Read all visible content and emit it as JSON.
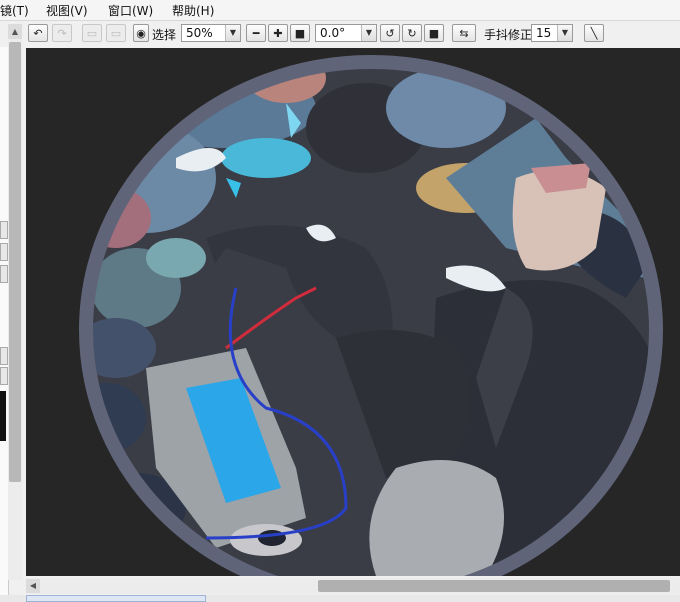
{
  "menubar": {
    "items": [
      "镜(T)",
      "视图(V)",
      "窗口(W)",
      "帮助(H)"
    ]
  },
  "toolbar": {
    "select_label": "选择",
    "zoom": "50%",
    "rotation": "0.0°",
    "stabilizer_label": "手抖修正",
    "stabilizer_value": "15"
  },
  "icons": {
    "undo": "undo-icon",
    "redo": "redo-icon",
    "eye": "eye-icon",
    "zoom_out": "minus-icon",
    "zoom_in": "plus-icon",
    "zoom_reset": "stop-icon",
    "rotate_ccw": "rotate-left-icon",
    "rotate_cw": "rotate-right-icon",
    "rotate_reset": "stop-icon",
    "flip": "flip-horizontal-icon",
    "pen": "line-tool-icon"
  },
  "colors": {
    "canvas_bg": "#262626",
    "frame": "#5f6478",
    "accent_blue": "#2ba6e8"
  }
}
